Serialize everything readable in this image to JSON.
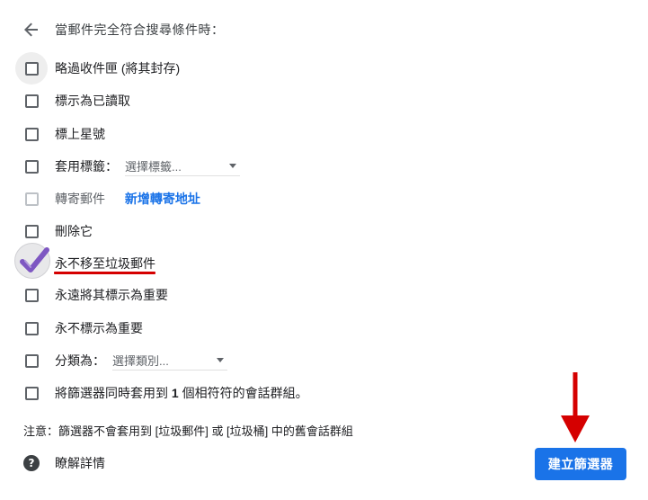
{
  "header": {
    "title": "當郵件完全符合搜尋條件時："
  },
  "options": [
    {
      "label": "略過收件匣 (將其封存)"
    },
    {
      "label": "標示為已讀取"
    },
    {
      "label": "標上星號"
    },
    {
      "label": "套用標籤：",
      "select_value": "選擇標籤..."
    },
    {
      "label": "轉寄郵件",
      "link": "新增轉寄地址",
      "disabled": true
    },
    {
      "label": "刪除它"
    },
    {
      "label": "永不移至垃圾郵件",
      "checked": true
    },
    {
      "label": "永遠將其標示為重要"
    },
    {
      "label": "永不標示為重要"
    },
    {
      "label": "分類為：",
      "select_value": "選擇類別..."
    },
    {
      "label_before": "將篩選器同時套用到 ",
      "label_count": "1",
      "label_after": " 個相符符的會話群組。"
    }
  ],
  "note": "注意：篩選器不會套用到 [垃圾郵件] 或 [垃圾桶] 中的舊會話群組",
  "help": {
    "icon": "help-icon",
    "text": "瞭解詳情"
  },
  "create_button": {
    "label": "建立篩選器"
  },
  "colors": {
    "accent": "#1a73e8",
    "annotation_red": "#d50000",
    "check_purple": "#7e57c2"
  }
}
